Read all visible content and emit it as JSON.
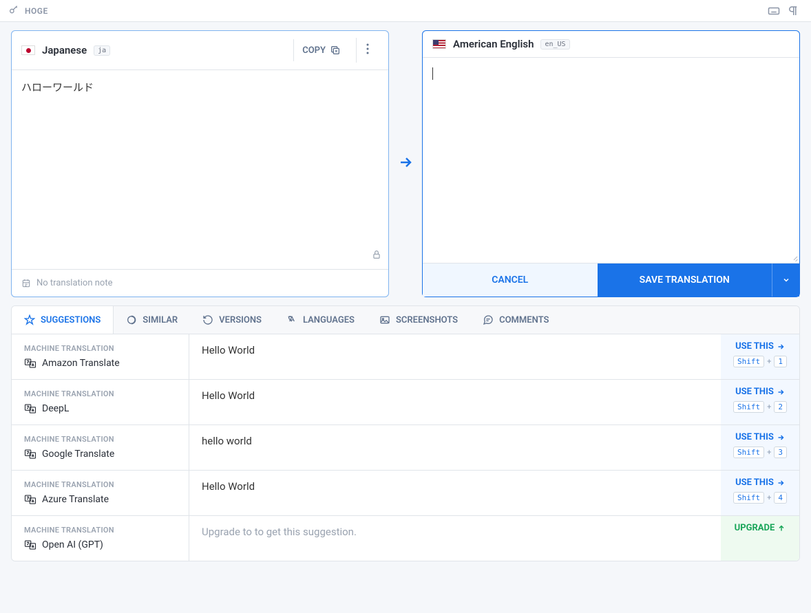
{
  "top": {
    "key": "HOGE"
  },
  "source": {
    "language": "Japanese",
    "code": "ja",
    "text": "ハローワールド",
    "copy_label": "COPY",
    "note": "No translation note"
  },
  "target": {
    "language": "American English",
    "code": "en_US",
    "cancel": "CANCEL",
    "save": "SAVE TRANSLATION"
  },
  "tabs": {
    "t0": "SUGGESTIONS",
    "t1": "SIMILAR",
    "t2": "VERSIONS",
    "t3": "LANGUAGES",
    "t4": "SCREENSHOTS",
    "t5": "COMMENTS"
  },
  "mt_group_label": "MACHINE TRANSLATION",
  "use_this_label": "USE THIS",
  "upgrade_label": "UPGRADE",
  "shift_key": "Shift",
  "suggestions": {
    "s0": {
      "provider": "Amazon Translate",
      "text": "Hello World",
      "num": "1"
    },
    "s1": {
      "provider": "DeepL",
      "text": "Hello World",
      "num": "2"
    },
    "s2": {
      "provider": "Google Translate",
      "text": "hello world",
      "num": "3"
    },
    "s3": {
      "provider": "Azure Translate",
      "text": "Hello World",
      "num": "4"
    },
    "s4": {
      "provider": "Open AI (GPT)",
      "text": "Upgrade to to get this suggestion."
    }
  }
}
